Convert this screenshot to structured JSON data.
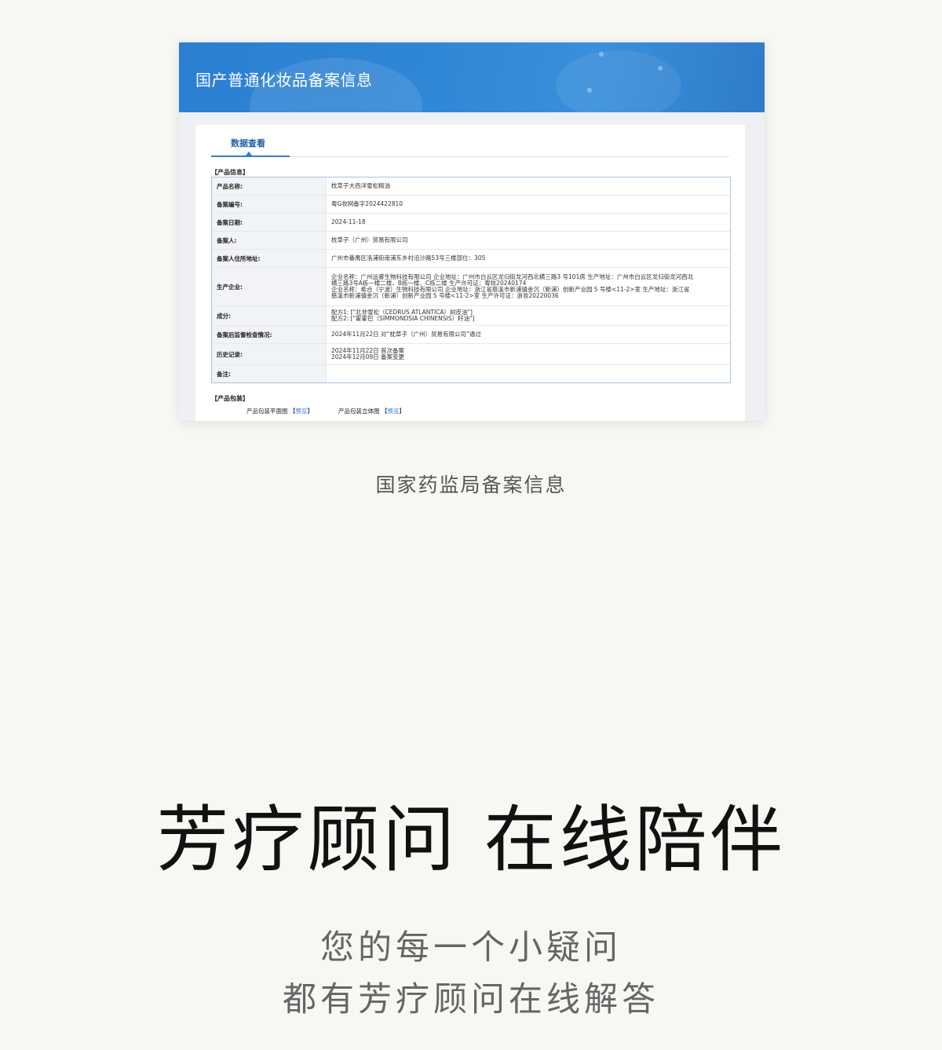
{
  "screenshot": {
    "banner_title": "国产普通化妆品备案信息",
    "tab_label": "数据查看",
    "section_product_info": "【产品信息】",
    "rows": [
      {
        "label": "产品名称:",
        "lines": [
          "枕草子大西洋雪松精油"
        ]
      },
      {
        "label": "备案编号:",
        "lines": [
          "粤G妆网备字2024422810"
        ]
      },
      {
        "label": "备案日期:",
        "lines": [
          "2024-11-18"
        ]
      },
      {
        "label": "备案人:",
        "lines": [
          "枕草子（广州）贸易有限公司"
        ]
      },
      {
        "label": "备案人住所地址:",
        "lines": [
          "广州市番禺区洛浦街南浦东乡村沿沙路53号三楼部位：305"
        ]
      },
      {
        "label": "生产企业:",
        "lines": [
          "企业名称：广州远睿生物科技有限公司 企业地址：广州市白云区龙归街龙河西北横三路3 号101房 生产地址：广州市白云区龙归街龙河西北",
          "横三路3号A栋一楼二楼、B栋一楼、C栋二楼 生产许可证：粤妆20240174",
          "企业名称：希合（宁波）生物科技有限公司 企业地址：浙江省慈溪市新浦镇金沉（新浦）创新产业园 5 号楼<11-2>室 生产地址：浙江省",
          "慈溪市新浦镇金沉（新浦）创新产业园 5 号楼<11-2>室 生产许可证：浙妆20220036"
        ]
      },
      {
        "label": "成分:",
        "lines": [
          "配方1: [\"北非雪松（CEDRUS ATLANTICA）树皮油\"]",
          "配方2: [\"霍霍巴（SIMMONDSIA CHINENSIS）籽油\"]"
        ]
      },
      {
        "label": "备案后监督检查情况:",
        "lines": [
          "2024年11月22日 对“枕草子（广州）贸易有限公司”通过"
        ]
      },
      {
        "label": "历史记录:",
        "lines": [
          "2024年11月22日 首次备案",
          "2024年12月09日 备案变更"
        ]
      },
      {
        "label": "备注:",
        "lines": []
      }
    ],
    "section_package": "【产品包装】",
    "package_items": [
      {
        "label": "产品包装平面图",
        "link_open": "【",
        "link_text": "预览",
        "link_close": "】"
      },
      {
        "label": "产品包装立体图",
        "link_open": "【",
        "link_text": "预览",
        "link_close": "】"
      }
    ]
  },
  "caption": "国家药监局备案信息",
  "headline": "芳疗顾问 在线陪伴",
  "subline_1": "您的每一个小疑问",
  "subline_2": "都有芳疗顾问在线解答"
}
